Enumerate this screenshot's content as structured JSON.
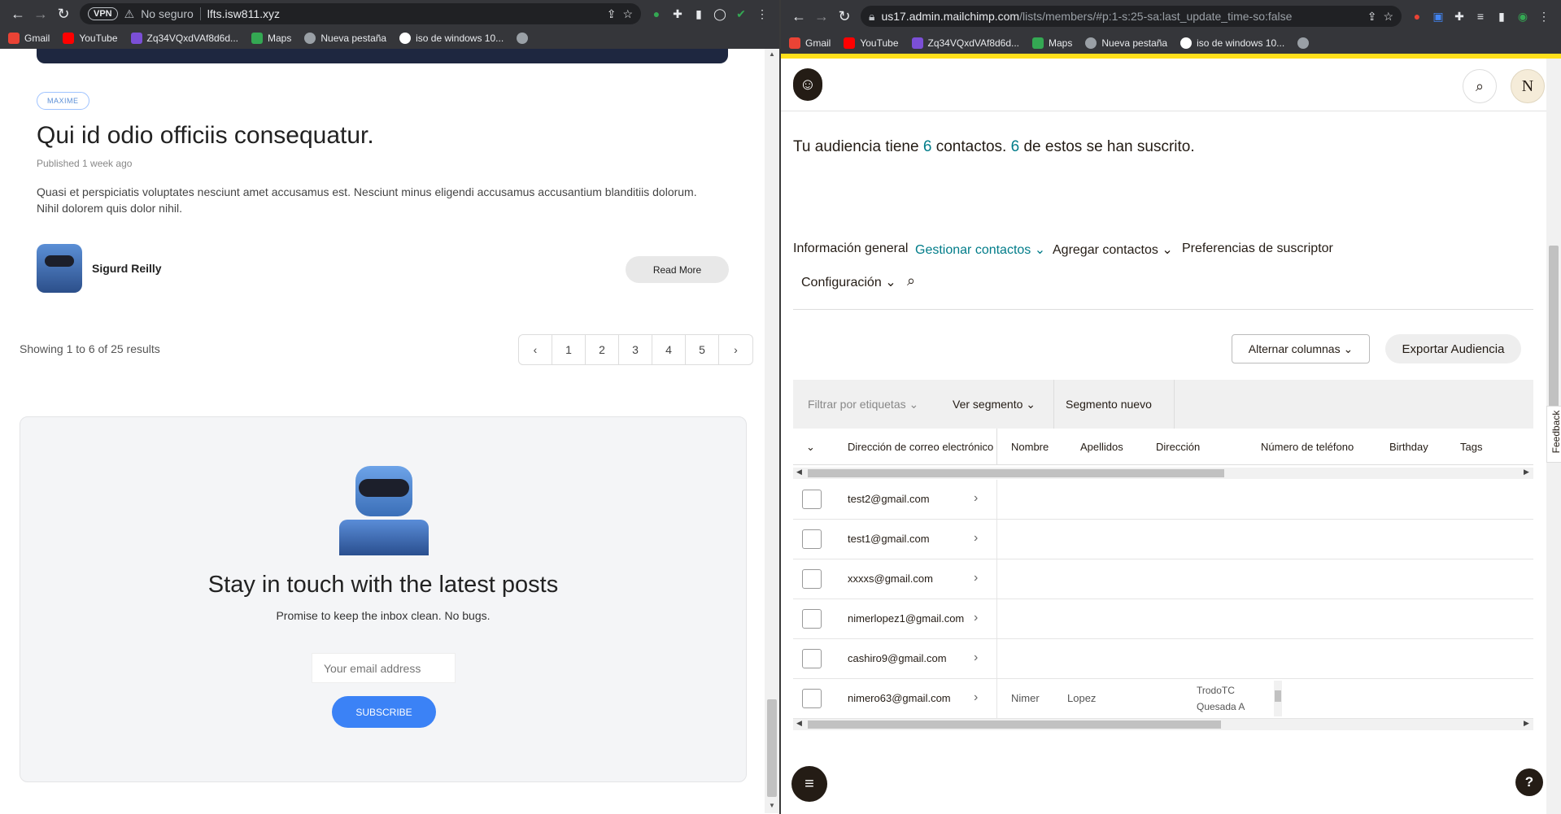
{
  "left": {
    "toolbar": {
      "vpn": "VPN",
      "security": "No seguro",
      "url": "lfts.isw811.xyz"
    },
    "bookmarks": [
      "Gmail",
      "YouTube",
      "Zq34VQxdVAf8d6d...",
      "Maps",
      "Nueva pestaña",
      "iso de windows 10..."
    ],
    "post": {
      "tag": "MAXIME",
      "title": "Qui id odio officiis consequatur.",
      "published": "Published 1 week ago",
      "excerpt": "Quasi et perspiciatis voluptates nesciunt amet accusamus est. Nesciunt minus eligendi accusamus accusantium blanditiis dolorum. Nihil dolorem quis dolor nihil.",
      "author": "Sigurd Reilly",
      "read_more": "Read More"
    },
    "pagination": {
      "summary": "Showing 1 to 6 of 25 results",
      "prev": "‹",
      "pages": [
        "1",
        "2",
        "3",
        "4",
        "5"
      ],
      "next": "›"
    },
    "newsletter": {
      "title": "Stay in touch with the latest posts",
      "subtitle": "Promise to keep the inbox clean. No bugs.",
      "placeholder": "Your email address",
      "button": "SUBSCRIBE"
    }
  },
  "right": {
    "toolbar": {
      "url_host": "us17.admin.mailchimp.com",
      "url_path": "/lists/members/#p:1-s:25-sa:last_update_time-so:false"
    },
    "bookmarks": [
      "Gmail",
      "YouTube",
      "Zq34VQxdVAf8d6d...",
      "Maps",
      "Nueva pestaña",
      "iso de windows 10..."
    ],
    "avatar_letter": "N",
    "audience": {
      "pre": "Tu audiencia tiene ",
      "count": "6",
      "mid": " contactos. ",
      "subscribed": "6",
      "post": " de estos se han suscrito."
    },
    "tabs": {
      "general": "Información general",
      "manage": "Gestionar contactos",
      "add": "Agregar contactos",
      "prefs": "Preferencias de suscriptor",
      "config": "Configuración"
    },
    "actions": {
      "toggle_columns": "Alternar columnas",
      "export": "Exportar Audiencia"
    },
    "filters": {
      "tags": "Filtrar por etiquetas",
      "segment": "Ver segmento",
      "new_segment": "Segmento nuevo"
    },
    "columns": [
      "Dirección de correo electrónico",
      "Nombre",
      "Apellidos",
      "Dirección",
      "Número de teléfono",
      "Birthday",
      "Tags"
    ],
    "rows": [
      {
        "email": "test2@gmail.com",
        "first": "",
        "last": ""
      },
      {
        "email": "test1@gmail.com",
        "first": "",
        "last": ""
      },
      {
        "email": "xxxxs@gmail.com",
        "first": "",
        "last": ""
      },
      {
        "email": "nimerlopez1@gmail.com",
        "first": "",
        "last": ""
      },
      {
        "email": "cashiro9@gmail.com",
        "first": "",
        "last": ""
      },
      {
        "email": "nimero63@gmail.com",
        "first": "Nimer",
        "last": "Lopez",
        "address_line1": "TrodoTC",
        "address_line2": "Quesada A"
      }
    ],
    "feedback": "Feedback",
    "help": "?"
  }
}
